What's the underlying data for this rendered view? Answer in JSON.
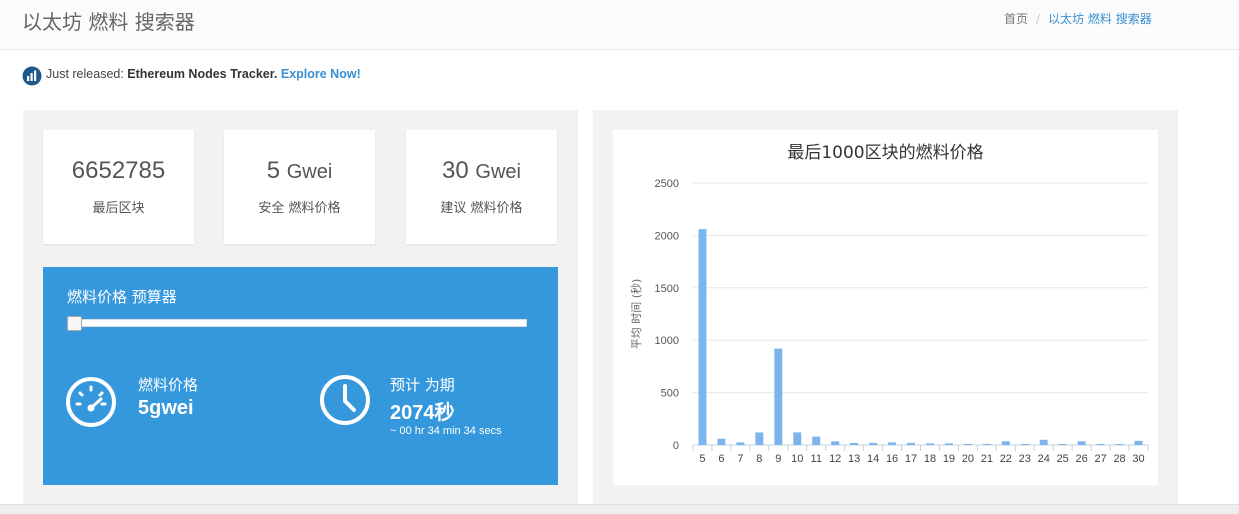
{
  "header": {
    "title": "以太坊 燃料 搜索器",
    "breadcrumb": {
      "home": "首页",
      "separator": "/",
      "current": "以太坊 燃料 搜索器"
    }
  },
  "announcement": {
    "prefix": "Just released: ",
    "highlight": "Ethereum Nodes Tracker.",
    "link": "Explore Now!"
  },
  "stats": [
    {
      "value": "6652785",
      "unit": "",
      "label": "最后区块"
    },
    {
      "value": "5",
      "unit": "Gwei",
      "label": "安全 燃料价格"
    },
    {
      "value": "30",
      "unit": "Gwei",
      "label": "建议 燃料价格"
    }
  ],
  "calculator": {
    "title": "燃料价格 预算器",
    "slider_value_fraction": 0,
    "gas_price_label": "燃料价格",
    "gas_price_value": "5gwei",
    "time_label": "预计 为期",
    "time_value": "2074秒",
    "time_detail": "~ 00 hr 34 min 34 secs"
  },
  "colors": {
    "accent": "#3598dc",
    "bar": "#7cb5ec",
    "link": "#3a8fd1"
  },
  "chart_data": {
    "type": "bar",
    "title": "最后1000区块的燃料价格",
    "ylabel": "平均 时间 (秒)",
    "xlabel": "",
    "ylim": [
      0,
      2500
    ],
    "yticks": [
      0,
      500,
      1000,
      1500,
      2000,
      2500
    ],
    "categories": [
      "5",
      "6",
      "7",
      "8",
      "9",
      "10",
      "11",
      "12",
      "13",
      "14",
      "16",
      "17",
      "18",
      "19",
      "20",
      "21",
      "22",
      "23",
      "24",
      "25",
      "26",
      "27",
      "28",
      "30"
    ],
    "values": [
      2060,
      60,
      25,
      120,
      920,
      120,
      80,
      35,
      20,
      20,
      25,
      20,
      15,
      15,
      10,
      10,
      35,
      10,
      50,
      10,
      35,
      10,
      10,
      40
    ]
  }
}
